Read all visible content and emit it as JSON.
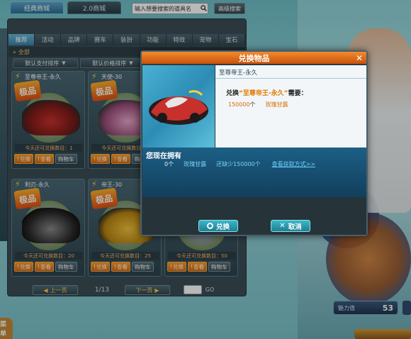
{
  "shop": {
    "tabs": [
      {
        "label": "经典商城"
      },
      {
        "label": "2.0商城"
      }
    ],
    "search_placeholder": "输入想要搜索的道具名",
    "search_button": "高级搜索",
    "categories": [
      {
        "label": "推荐"
      },
      {
        "label": "活动"
      },
      {
        "label": "品牌"
      },
      {
        "label": "赛车"
      },
      {
        "label": "装扮"
      },
      {
        "label": "功能"
      },
      {
        "label": "特效"
      },
      {
        "label": "宠物"
      },
      {
        "label": "宝石"
      }
    ],
    "breadcrumb": "全部",
    "sort": {
      "pay": "默认支付排序",
      "price": "默认价格排序"
    },
    "cards": [
      {
        "name": "至尊帝王-永久",
        "badge": "极品",
        "limit": "今天还可兑换数目：1",
        "buttons": [
          "兑换",
          "查看",
          "购物车"
        ]
      },
      {
        "name": "天使-30",
        "badge": "极品",
        "limit": "今天还可兑换数目：1",
        "buttons": [
          "兑换",
          "查看",
          "购物车"
        ]
      },
      {
        "name": "利刃-永久",
        "badge": "极品",
        "limit": "今天还可兑换数目：20",
        "buttons": [
          "兑换",
          "查看",
          "购物车"
        ]
      },
      {
        "name": "帝王-30",
        "badge": "极品",
        "limit": "今天还可兑换数目：25",
        "buttons": [
          "兑换",
          "查看",
          "购物车"
        ]
      },
      {
        "name": "",
        "badge": "",
        "limit": "今天还可兑换数目：50",
        "buttons": [
          "兑换",
          "查看",
          "购物车"
        ]
      }
    ],
    "pagination": {
      "prev": "上一页",
      "page": "1/13",
      "next": "下一页",
      "go": "GO"
    }
  },
  "modal": {
    "title": "兑换物品",
    "close": "✕",
    "item_name": "至尊帝王-永久",
    "exchange_prefix": "兑换",
    "exchange_item": "“至尊帝王-永久”",
    "exchange_suffix": "需要：",
    "cost_amount": "150000",
    "cost_unit": "个",
    "cost_currency": "玫瑰甘露",
    "own_title": "您现在拥有",
    "own_amount": "0个",
    "own_currency": "玫瑰甘露",
    "lack": "还缺少150000个",
    "how_to_get": "查看获取方式>>",
    "ok": "兑换",
    "cancel": "取消"
  },
  "hud": {
    "power_label": "魅力值",
    "power_value": "53",
    "corner_label": "菜单"
  },
  "colors": {
    "accent_orange": "#f28b2f",
    "modal_blue": "#1c5f86",
    "button_teal": "#3bb7c9",
    "highlight_text": "#e07a00"
  }
}
